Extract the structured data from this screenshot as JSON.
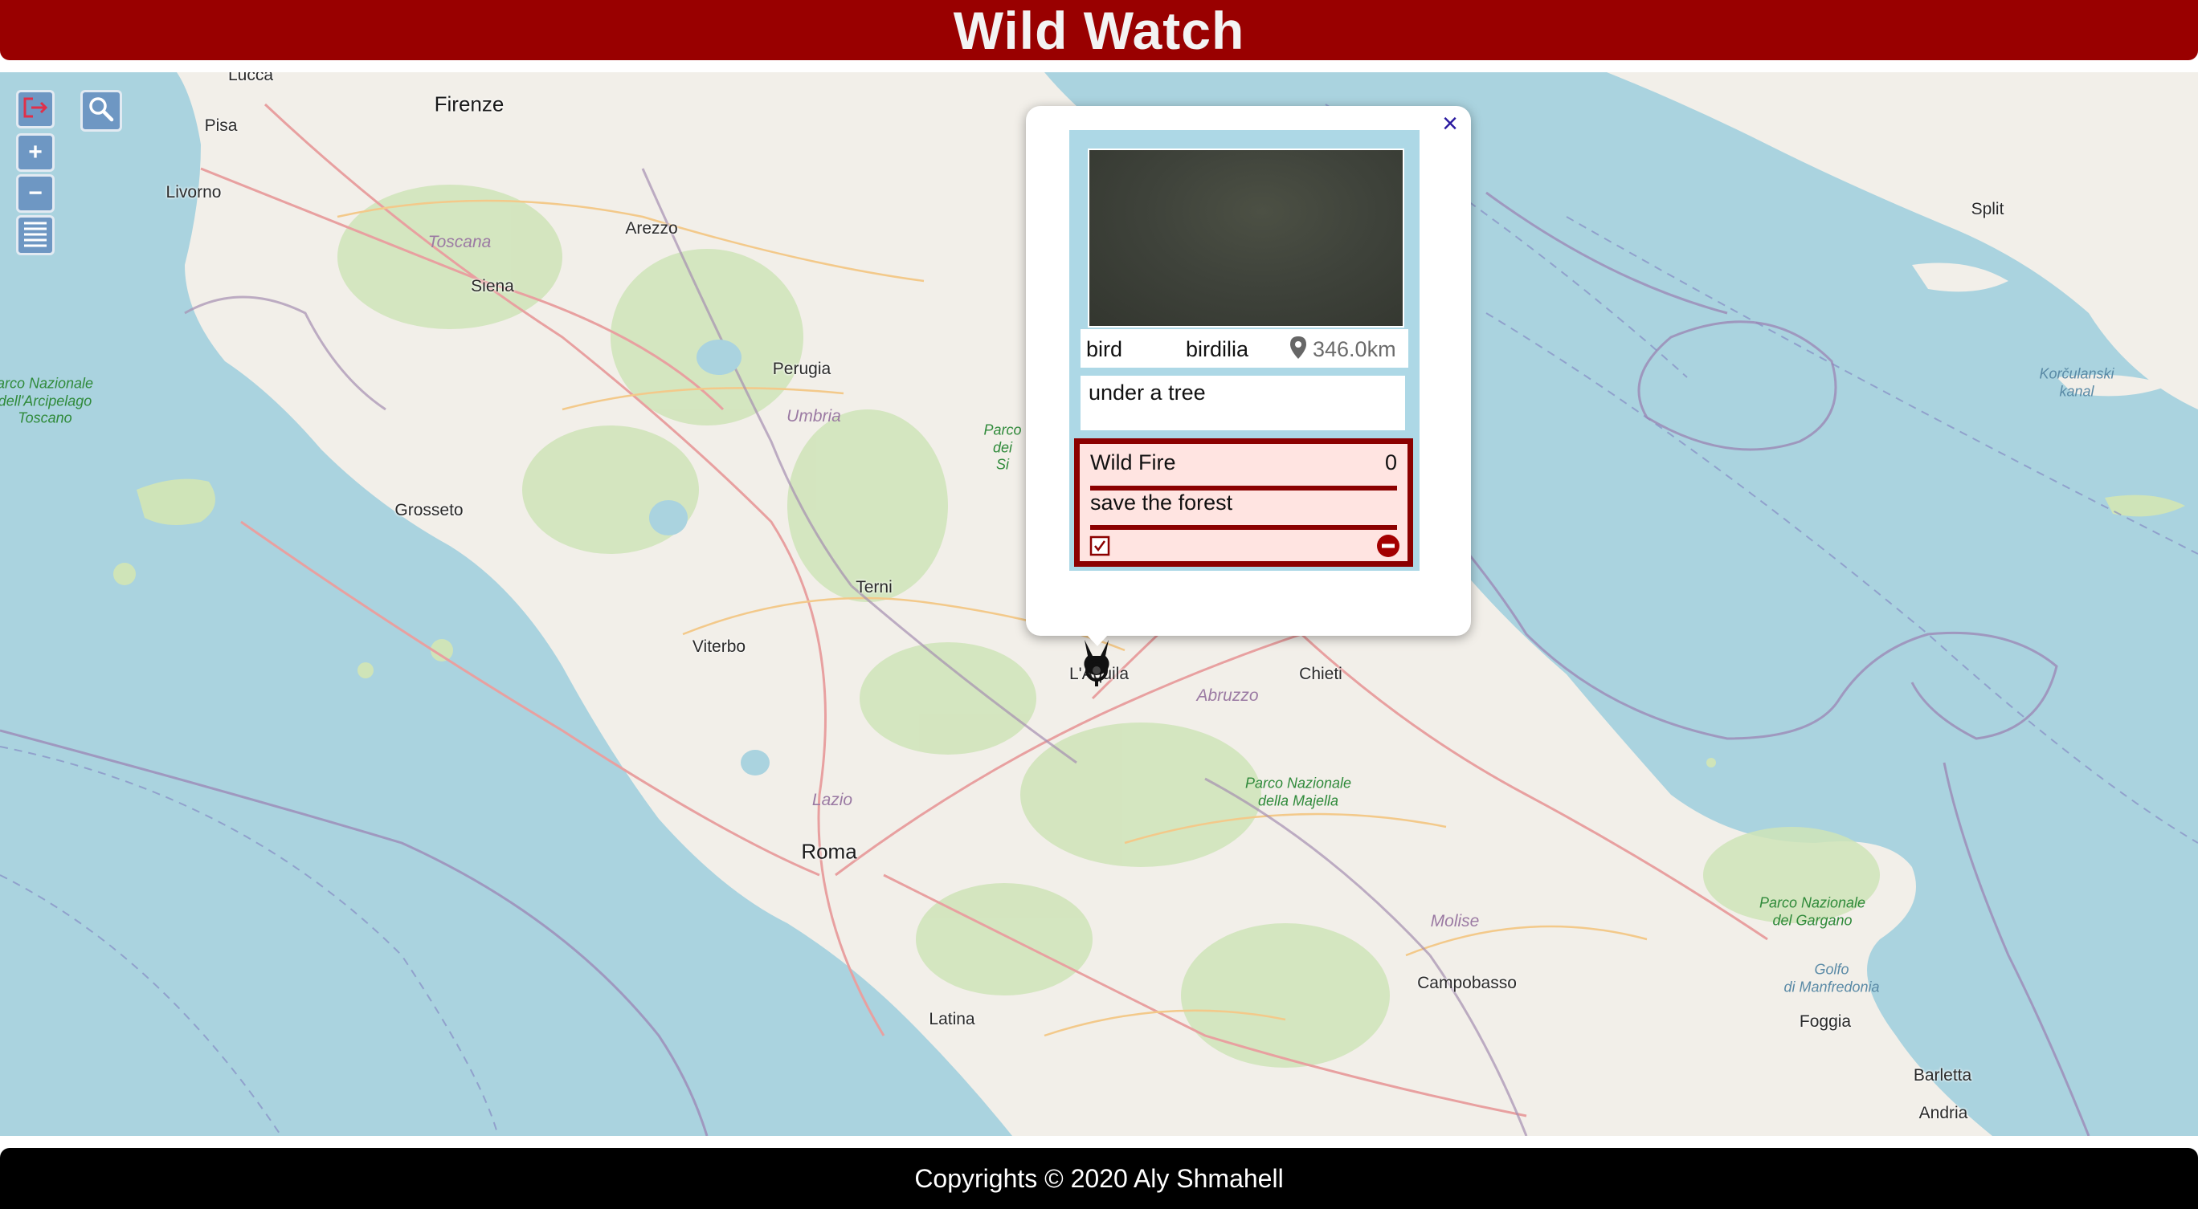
{
  "header": {
    "title": "Wild Watch"
  },
  "map": {
    "places": {
      "lucca": "Lucca",
      "firenze": "Firenze",
      "pisa": "Pisa",
      "livorno": "Livorno",
      "arezzo": "Arezzo",
      "toscana": "Toscana",
      "siena": "Siena",
      "perugia": "Perugia",
      "umbria": "Umbria",
      "grosseto": "Grosseto",
      "terni": "Terni",
      "viterbo": "Viterbo",
      "lazio": "Lazio",
      "roma": "Roma",
      "latina": "Latina",
      "abruzzo": "Abruzzo",
      "chieti": "Chieti",
      "laquila": "L'Aquila",
      "molise": "Molise",
      "campobasso": "Campobasso",
      "foggia": "Foggia",
      "barletta": "Barletta",
      "andria": "Andria",
      "split": "Split",
      "park_arcipelago": "arco Nazionale\ndell'Arcipelago\nToscano",
      "park_majella": "Parco Nazionale\ndella Majella",
      "park_gargano": "Parco Nazionale\ndel Gargano",
      "park_partial": "Parco\ndei\nSi",
      "korculanski": "Korčulanski\nkanal",
      "golfo": "Golfo\ndi Manfredonia"
    },
    "controls": {
      "logout_icon": "logout-icon",
      "search_icon": "search-icon",
      "zoom_in": "+",
      "zoom_out": "−",
      "layers_icon": "list-icon"
    },
    "marker_icon": "animal-marker-icon"
  },
  "popup": {
    "close_label": "×",
    "sighting": {
      "category": "bird",
      "name": "birdilia",
      "distance": "346.0km",
      "description": "under a tree"
    },
    "event": {
      "title": "Wild Fire",
      "count": "0",
      "description": "save the forest",
      "checkbox_icon": "checkbox-icon",
      "remove_icon": "remove-icon"
    }
  },
  "colors": {
    "brand": "#990000",
    "event_border": "#8b0000",
    "event_bg": "#ffe4e1",
    "card_bg": "#add8e6",
    "sea": "#aad3df",
    "land": "#f2efe9"
  },
  "footer": {
    "copyright": "Copyrights © 2020 Aly Shmahell"
  }
}
